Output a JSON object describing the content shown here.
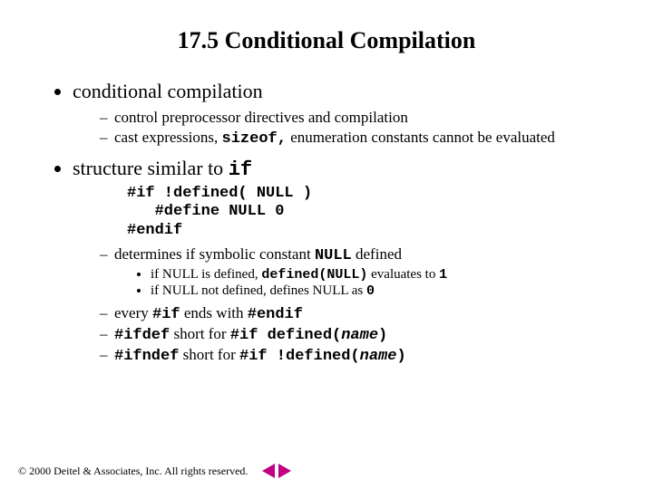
{
  "title": "17.5  Conditional Compilation",
  "b1": {
    "text": "conditional compilation",
    "s1": "control preprocessor directives and compilation",
    "s2a": "cast expressions, ",
    "s2b": "sizeof,",
    "s2c": "  enumeration constants cannot be evaluated"
  },
  "b2": {
    "texta": "structure similar to ",
    "textb": "if",
    "code": "#if !defined( NULL )\n   #define NULL 0\n#endif",
    "s1a": "determines if symbolic constant ",
    "s1b": "NULL",
    "s1c": " defined",
    "ss1a": "if NULL is defined, ",
    "ss1b": "defined(NULL)",
    "ss1c": " evaluates to ",
    "ss1d": "1",
    "ss2a": "if NULL not defined, defines NULL as ",
    "ss2b": "0",
    "s2a": "every ",
    "s2b": "#if",
    "s2c": " ends with ",
    "s2d": "#endif",
    "s3a": "#ifdef",
    "s3b": " short for ",
    "s3c": "#if defined(",
    "s3d": "name",
    "s3e": ")",
    "s4a": "#ifndef",
    "s4b": " short for ",
    "s4c": "#if !defined(",
    "s4d": "name",
    "s4e": ")"
  },
  "footer": {
    "copy": "© 2000 Deitel & Associates, Inc.  All rights reserved."
  }
}
